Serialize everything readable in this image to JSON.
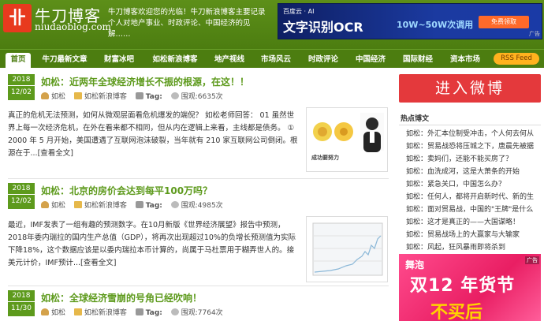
{
  "header": {
    "logo_char": "卝",
    "site_name": "牛刀博客",
    "domain": "niudaoblog.com",
    "description": "牛刀博客欢迎您的光临！牛刀新浪博客主要记录个人对地产事业、时政评论、中国经济的见解……"
  },
  "top_ad": {
    "brand": "百度云 · AI",
    "title": "文字识别OCR",
    "subtitle": "10W~50W次调用",
    "cta": "免费领取",
    "tag": "广告"
  },
  "nav": {
    "items": [
      "首页",
      "牛刀最新文章",
      "财富冰吧",
      "如松新浪博客",
      "地产视线",
      "市场风云",
      "时政评论",
      "中国经济",
      "国际财经",
      "资本市场"
    ],
    "rss": "RSS Feed"
  },
  "posts": [
    {
      "year": "2018",
      "month_day": "12/02",
      "title": "如松：近两年全球经济增长不振的根源，在这！！",
      "author": "如松",
      "category": "如松新浪博客",
      "tag_label": "Tag:",
      "views": "围观:6635次",
      "excerpt": "真正的危机无法预测，如何从微观层面看危机爆发的端倪？ 如松老师回答： 01 虽然世界上每一次经济危机，在外在看来都不相同，但从内在逻辑上来看，主线都是债务。 ① 2000 年 5 月开始，美国遭遇了互联网泡沫破裂，当年就有 210 家互联网公司倒闭。根源在于...",
      "readmore": "[查看全文]",
      "thumb_caption": "成功要努力"
    },
    {
      "year": "2018",
      "month_day": "12/02",
      "title": "如松：北京的房价会达到每平100万吗？",
      "author": "如松",
      "category": "如松新浪博客",
      "tag_label": "Tag:",
      "views": "围观:4985次",
      "excerpt": "最近，IMF发表了一组有趣的预测数字。在10月新版《世界经济展望》报告中预测，2018年委内瑞拉的国内生产总值（GDP），将再次出现超过10%的负增长预测值为实际下降18%，这个数据应该是以委内瑞拉本币计算的，尚属于马杜票用于糊弄世人的。接美元计价，IMF预计...",
      "readmore": "[查看全文]"
    },
    {
      "year": "2018",
      "month_day": "11/30",
      "title": "如松：全球经济雪崩的号角已经吹响！",
      "author": "如松",
      "category": "如松新浪博客",
      "tag_label": "Tag:",
      "views": "围观:7764次"
    }
  ],
  "sidebar": {
    "weibo_button": "进入微博",
    "hot_title": "热点博文",
    "hot_items": [
      "如松：外汇本位制受冲击，个人何去何从",
      "如松：贸易战恐将压城之下，唐晨先被据",
      "如松：卖妈们，还能不能买房了？",
      "如松：血洗成河，这是大萧条的开始",
      "如松：紧急关口，中国怎么办？",
      "如松：任何人，都将开启新时代、新的生",
      "如松：面对贸易战，中国的\"王牌\"是什么",
      "如松：这才是真正的——大国谋略！",
      "如松：贸易战场上的大赢家与大输家",
      "如松：风起，狂风暴雨即将杀到"
    ]
  },
  "side_ad": {
    "logo": "舞泡",
    "tag": "广告",
    "line1": "双12 年货节",
    "line2": "不买后"
  },
  "colors": {
    "brand_green": "#4c7d10",
    "accent_green": "#5d9a1c",
    "weibo_red": "#e4393c"
  }
}
